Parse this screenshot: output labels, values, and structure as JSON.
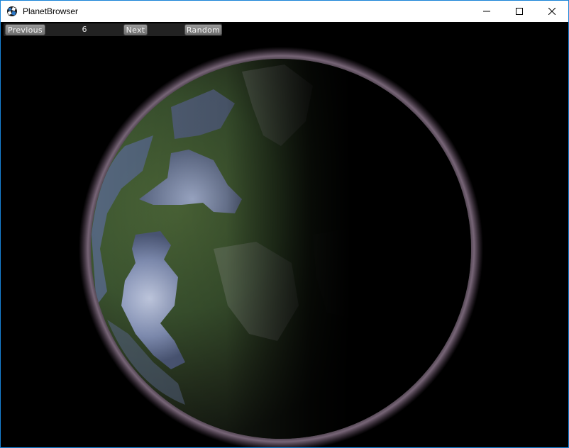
{
  "window": {
    "title": "PlanetBrowser",
    "icon": "planetbrowser-app-icon",
    "controls": {
      "minimize_icon": "minimize-icon",
      "maximize_icon": "maximize-icon",
      "close_icon": "close-icon"
    },
    "border_color": "#1883d7"
  },
  "toolbar": {
    "previous_label": "Previous",
    "index_value": "6",
    "next_label": "Next",
    "random_label": "Random"
  },
  "scene": {
    "subject": "planet",
    "background_color": "#000000",
    "atmosphere_color": "#d8b8d8"
  }
}
